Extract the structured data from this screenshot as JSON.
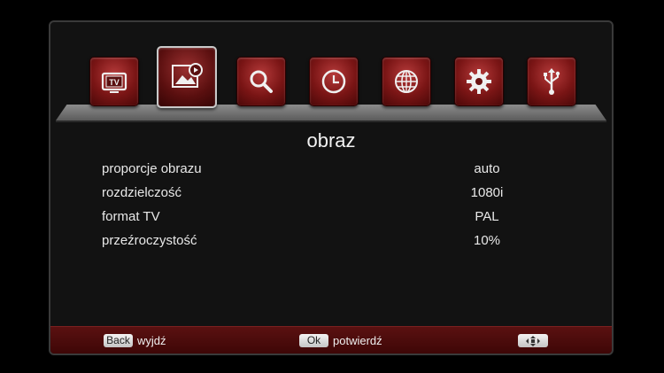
{
  "menu": {
    "icons": [
      {
        "name": "tv-icon",
        "active": false
      },
      {
        "name": "picture-icon",
        "active": true
      },
      {
        "name": "search-icon",
        "active": false
      },
      {
        "name": "clock-icon",
        "active": false
      },
      {
        "name": "globe-icon",
        "active": false
      },
      {
        "name": "gear-icon",
        "active": false
      },
      {
        "name": "usb-icon",
        "active": false
      }
    ]
  },
  "section": {
    "title": "obraz"
  },
  "settings": [
    {
      "label": "proporcje obrazu",
      "value": "auto"
    },
    {
      "label": "rozdzielczość",
      "value": "1080i"
    },
    {
      "label": "format TV",
      "value": "PAL"
    },
    {
      "label": "przeźroczystość",
      "value": "10%"
    }
  ],
  "footer": {
    "back_key": "Back",
    "back_label": "wyjdź",
    "ok_key": "Ok",
    "ok_label": "potwierdź",
    "nav_key_icon": "four-arrows-icon"
  },
  "colors": {
    "accent": "#7a1515",
    "footer": "#4a0a0a",
    "background": "#121212"
  }
}
